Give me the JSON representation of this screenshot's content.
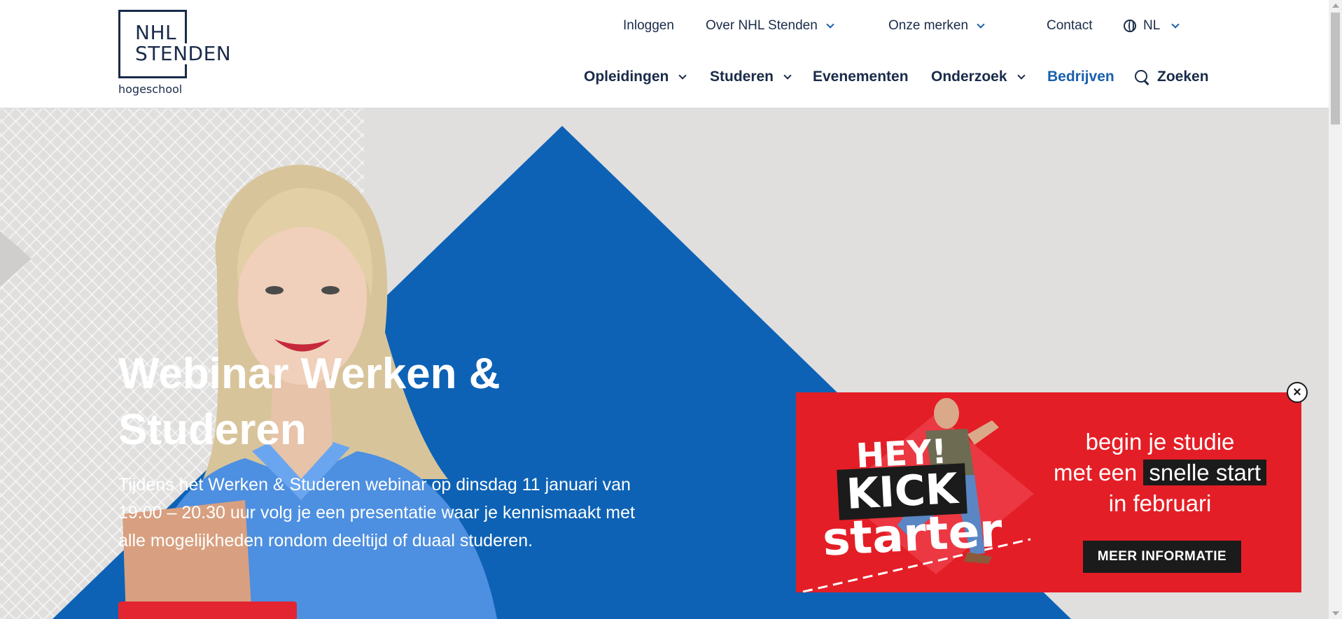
{
  "logo": {
    "line1": "NHL",
    "line2": "STENDEN",
    "sub": "hogeschool"
  },
  "topnav": {
    "login": "Inloggen",
    "about": "Over NHL Stenden",
    "brands": "Onze merken",
    "contact": "Contact",
    "lang": "NL"
  },
  "mainnav": {
    "programs": "Opleidingen",
    "study": "Studeren",
    "events": "Evenementen",
    "research": "Onderzoek",
    "business": "Bedrijven",
    "search": "Zoeken"
  },
  "hero": {
    "title": "Webinar Werken & Studeren",
    "text": "Tijdens het Werken & Studeren webinar op dinsdag 11 januari van 19.00 – 20.30 uur volg je een presentatie waar je kennismaakt met alle mogelijkheden rondom deeltijd of duaal studeren."
  },
  "promo": {
    "hey": "HEY!",
    "kick": "KICK",
    "starter": "starter",
    "line1": "begin je studie",
    "line2_pre": "met een",
    "line2_hl": "snelle start",
    "line3": "in februari",
    "button": "MEER INFORMATIE",
    "close": "×"
  },
  "colors": {
    "navy": "#1a2b49",
    "blue": "#0d62b5",
    "link_blue": "#1a5fae",
    "red": "#e41e26",
    "hero_bg": "#e0dfde"
  }
}
